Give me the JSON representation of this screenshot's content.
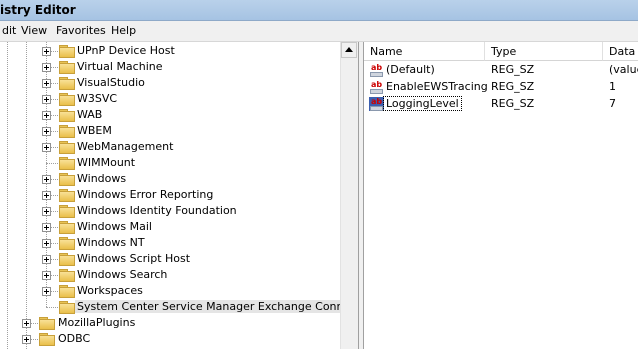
{
  "window": {
    "title": "istry Editor"
  },
  "menu": {
    "items": [
      "dit",
      "View",
      "Favorites",
      "Help"
    ]
  },
  "tree": {
    "items": [
      {
        "label": "UPnP Device Host",
        "expandable": true,
        "selected": false
      },
      {
        "label": "Virtual Machine",
        "expandable": true,
        "selected": false
      },
      {
        "label": "VisualStudio",
        "expandable": true,
        "selected": false
      },
      {
        "label": "W3SVC",
        "expandable": true,
        "selected": false
      },
      {
        "label": "WAB",
        "expandable": true,
        "selected": false
      },
      {
        "label": "WBEM",
        "expandable": true,
        "selected": false
      },
      {
        "label": "WebManagement",
        "expandable": true,
        "selected": false
      },
      {
        "label": "WIMMount",
        "expandable": false,
        "selected": false
      },
      {
        "label": "Windows",
        "expandable": true,
        "selected": false
      },
      {
        "label": "Windows Error Reporting",
        "expandable": true,
        "selected": false
      },
      {
        "label": "Windows Identity Foundation",
        "expandable": true,
        "selected": false
      },
      {
        "label": "Windows Mail",
        "expandable": true,
        "selected": false
      },
      {
        "label": "Windows NT",
        "expandable": true,
        "selected": false
      },
      {
        "label": "Windows Script Host",
        "expandable": true,
        "selected": false
      },
      {
        "label": "Windows Search",
        "expandable": true,
        "selected": false
      },
      {
        "label": "Workspaces",
        "expandable": true,
        "selected": false
      },
      {
        "label": "System Center Service Manager Exchange Connector",
        "expandable": false,
        "selected": true
      }
    ],
    "parent_items": [
      {
        "label": "MozillaPlugins",
        "expandable": true
      },
      {
        "label": "ODBC",
        "expandable": true
      }
    ]
  },
  "list": {
    "columns": [
      "Name",
      "Type",
      "Data"
    ],
    "rows": [
      {
        "name": "(Default)",
        "type": "REG_SZ",
        "data": "(value",
        "selected": false
      },
      {
        "name": "EnableEWSTracing",
        "type": "REG_SZ",
        "data": "1",
        "selected": false
      },
      {
        "name": "LoggingLevel",
        "type": "REG_SZ",
        "data": "7",
        "selected": true
      }
    ]
  },
  "icons": {
    "folder": "folder-icon",
    "string_value": "string-value-icon",
    "expander": "expand-plus-icon",
    "scroll_up": "scroll-up-arrow-icon"
  }
}
